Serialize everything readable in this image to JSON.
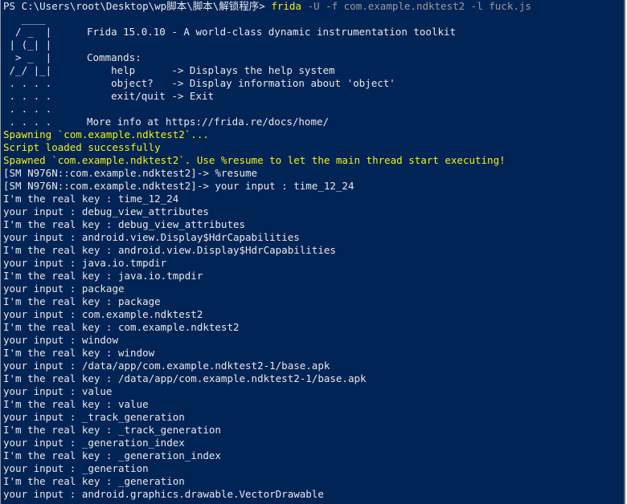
{
  "prompt": {
    "ps_path": "PS C:\\Users\\root\\Desktop\\wp脚本\\脚本\\解锁程序>",
    "command": "frida",
    "args": "-U -f com.example.ndktest2 -l fuck.js"
  },
  "banner": {
    "logo": [
      "   ____",
      "  / _  |",
      " | (_| |",
      "  > _  |",
      " /_/ |_|",
      " . . . .",
      " . . . .",
      " . . . .",
      " . . . ."
    ],
    "title": "Frida 15.0.10 - A world-class dynamic instrumentation toolkit",
    "commands_header": "Commands:",
    "commands": [
      "    help      -> Displays the help system",
      "    object?   -> Display information about 'object'",
      "    exit/quit -> Exit"
    ],
    "more_info": "More info at https://frida.re/docs/home/"
  },
  "status": {
    "spawning": "Spawning `com.example.ndktest2`...",
    "script_loaded": "Script loaded successfully",
    "spawned": "Spawned `com.example.ndktest2`. Use %resume to let the main thread start executing!"
  },
  "repl": [
    "[SM N976N::com.example.ndktest2]-> %resume",
    "[SM N976N::com.example.ndktest2]-> your input : time_12_24"
  ],
  "output_lines": [
    "I'm the real key : time_12_24",
    "your input : debug_view_attributes",
    "I'm the real key : debug_view_attributes",
    "your input : android.view.Display$HdrCapabilities",
    "I'm the real key : android.view.Display$HdrCapabilities",
    "your input : java.io.tmpdir",
    "I'm the real key : java.io.tmpdir",
    "your input : package",
    "I'm the real key : package",
    "your input : com.example.ndktest2",
    "I'm the real key : com.example.ndktest2",
    "your input : window",
    "I'm the real key : window",
    "your input : /data/app/com.example.ndktest2-1/base.apk",
    "I'm the real key : /data/app/com.example.ndktest2-1/base.apk",
    "your input : value",
    "I'm the real key : value",
    "your input : _track_generation",
    "I'm the real key : _track_generation",
    "your input : _generation_index",
    "I'm the real key : _generation_index",
    "your input : _generation",
    "I'm the real key : _generation",
    "your input : android.graphics.drawable.VectorDrawable"
  ],
  "colors": {
    "background": "#012456",
    "text": "#e8e8e8",
    "highlight": "#f1f10f",
    "args": "#9a9a9a"
  }
}
